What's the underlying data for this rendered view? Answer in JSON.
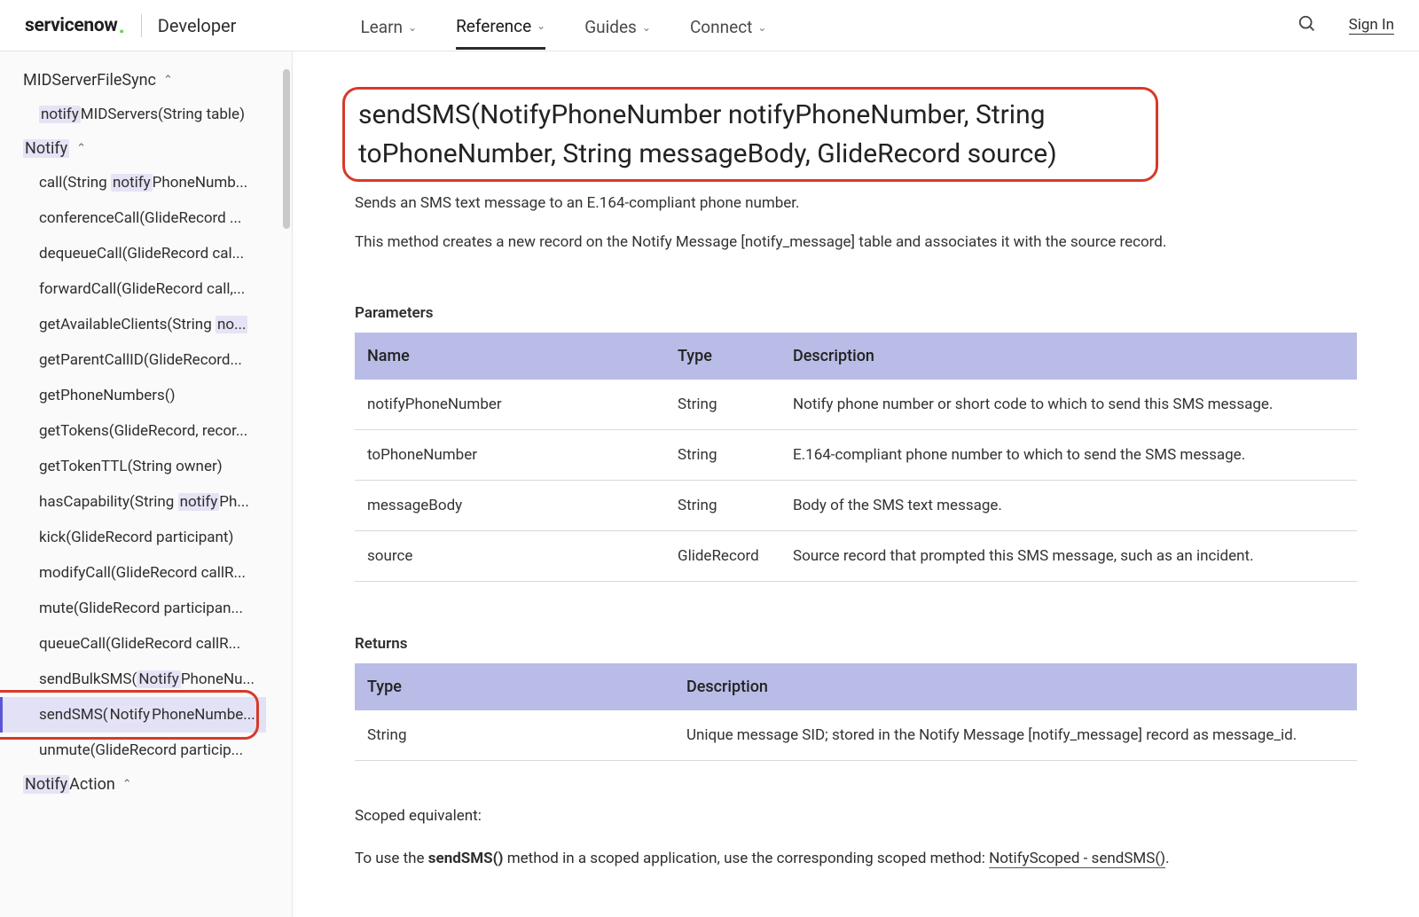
{
  "header": {
    "brand": "servicenow",
    "portal": "Developer",
    "nav": [
      "Learn",
      "Reference",
      "Guides",
      "Connect"
    ],
    "active_nav_index": 1,
    "signin": "Sign In"
  },
  "sidebar": {
    "group1": {
      "title_pre": "MIDServerFileSync"
    },
    "group1_items": [
      {
        "pre": "",
        "hl": "notify",
        "post": "MIDServers(String table)"
      }
    ],
    "group2": {
      "hl": "Notify"
    },
    "group2_items": [
      {
        "pre": "call(String ",
        "hl": "notify",
        "post": "PhoneNumb..."
      },
      {
        "pre": "conferenceCall(GlideRecord ...",
        "hl": "",
        "post": ""
      },
      {
        "pre": "dequeueCall(GlideRecord cal...",
        "hl": "",
        "post": ""
      },
      {
        "pre": "forwardCall(GlideRecord call,...",
        "hl": "",
        "post": ""
      },
      {
        "pre": "getAvailableClients(String ",
        "hl": "no...",
        "post": ""
      },
      {
        "pre": "getParentCallID(GlideRecord...",
        "hl": "",
        "post": ""
      },
      {
        "pre": "getPhoneNumbers()",
        "hl": "",
        "post": ""
      },
      {
        "pre": "getTokens(GlideRecord, recor...",
        "hl": "",
        "post": ""
      },
      {
        "pre": "getTokenTTL(String owner)",
        "hl": "",
        "post": ""
      },
      {
        "pre": "hasCapability(String ",
        "hl": "notify",
        "post": "Ph..."
      },
      {
        "pre": "kick(GlideRecord participant)",
        "hl": "",
        "post": ""
      },
      {
        "pre": "modifyCall(GlideRecord callR...",
        "hl": "",
        "post": ""
      },
      {
        "pre": "mute(GlideRecord participan...",
        "hl": "",
        "post": ""
      },
      {
        "pre": "queueCall(GlideRecord callR...",
        "hl": "",
        "post": ""
      },
      {
        "pre": "sendBulkSMS(",
        "hl": "Notify",
        "post": "PhoneNu..."
      },
      {
        "pre": "sendSMS(",
        "hl": "Notify",
        "post": "PhoneNumbe...",
        "selected": true
      },
      {
        "pre": "unmute(GlideRecord particip...",
        "hl": "",
        "post": ""
      }
    ],
    "group3": {
      "title_pre": "",
      "hl": "Notify",
      "title_post": "Action"
    }
  },
  "content": {
    "title": "sendSMS(NotifyPhoneNumber notifyPhoneNumber, String toPhoneNumber, String messageBody, GlideRecord source)",
    "lead": "Sends an SMS text message to an E.164-compliant phone number.",
    "desc": "This method creates a new record on the Notify Message [notify_message] table and associates it with the source record.",
    "params_label": "Parameters",
    "params_headers": [
      "Name",
      "Type",
      "Description"
    ],
    "params_rows": [
      [
        "notifyPhoneNumber",
        "String",
        "Notify phone number or short code to which to send this SMS message."
      ],
      [
        "toPhoneNumber",
        "String",
        "E.164-compliant phone number to which to send the SMS message."
      ],
      [
        "messageBody",
        "String",
        "Body of the SMS text message."
      ],
      [
        "source",
        "GlideRecord",
        "Source record that prompted this SMS message, such as an incident."
      ]
    ],
    "returns_label": "Returns",
    "returns_headers": [
      "Type",
      "Description"
    ],
    "returns_rows": [
      [
        "String",
        "Unique message SID; stored in the Notify Message [notify_message] record as message_id."
      ]
    ],
    "scoped_label": "Scoped equivalent:",
    "scoped_pre": "To use the ",
    "scoped_bold": "sendSMS()",
    "scoped_mid": " method in a scoped application, use the corresponding scoped method: ",
    "scoped_link": "NotifyScoped - sendSMS()",
    "scoped_post": "."
  }
}
